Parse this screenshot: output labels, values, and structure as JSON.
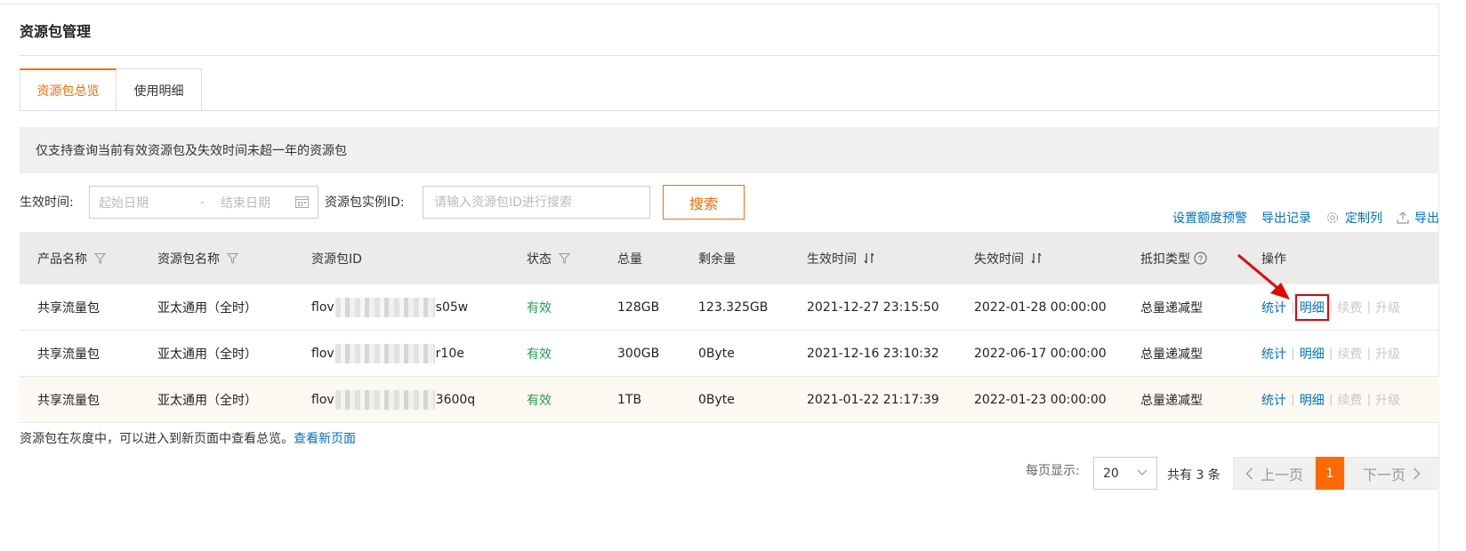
{
  "page": {
    "title": "资源包管理"
  },
  "tabs": [
    {
      "label": "资源包总览",
      "active": true
    },
    {
      "label": "使用明细",
      "active": false
    }
  ],
  "notice": "仅支持查询当前有效资源包及失效时间未超一年的资源包",
  "filters": {
    "time_label": "生效时间:",
    "start_placeholder": "起始日期",
    "range_sep": "-",
    "end_placeholder": "结束日期",
    "id_label": "资源包实例ID:",
    "id_placeholder": "请输入资源包ID进行搜索",
    "search_label": "搜索"
  },
  "toolbar": {
    "quota_alert": "设置额度预警",
    "export_records": "导出记录",
    "custom_columns": "定制列",
    "export": "导出"
  },
  "columns": {
    "product": "产品名称",
    "package_name": "资源包名称",
    "package_id": "资源包ID",
    "status": "状态",
    "total": "总量",
    "remaining": "剩余量",
    "effective_time": "生效时间",
    "expire_time": "失效时间",
    "deduct_type": "抵扣类型",
    "actions": "操作"
  },
  "rows": [
    {
      "product": "共享流量包",
      "package_name": "亚太通用（全时）",
      "id_prefix": "flov",
      "id_suffix": "s05w",
      "status": "有效",
      "total": "128GB",
      "remaining": "123.325GB",
      "effective_time": "2021-12-27 23:15:50",
      "expire_time": "2022-01-28 00:00:00",
      "deduct_type": "总量递减型"
    },
    {
      "product": "共享流量包",
      "package_name": "亚太通用（全时）",
      "id_prefix": "flov",
      "id_suffix": "r10e",
      "status": "有效",
      "total": "300GB",
      "remaining": "0Byte",
      "effective_time": "2021-12-16 23:10:32",
      "expire_time": "2022-06-17 00:00:00",
      "deduct_type": "总量递减型"
    },
    {
      "product": "共享流量包",
      "package_name": "亚太通用（全时）",
      "id_prefix": "flov",
      "id_suffix": "3600q",
      "status": "有效",
      "total": "1TB",
      "remaining": "0Byte",
      "effective_time": "2021-01-22 21:17:39",
      "expire_time": "2022-01-23 00:00:00",
      "deduct_type": "总量递减型"
    }
  ],
  "row_actions": {
    "stats": "统计",
    "detail": "明细",
    "renew": "续费",
    "upgrade": "升级"
  },
  "footnote": {
    "text": "资源包在灰度中，可以进入到新页面中查看总览。",
    "link": "查看新页面"
  },
  "pagination": {
    "per_page_label": "每页显示:",
    "per_page_value": "20",
    "total_text": "共有 3 条",
    "prev": "上一页",
    "current_page": "1",
    "next": "下一页"
  },
  "colors": {
    "accent": "#ff6a00",
    "link": "#0070cc",
    "status_ok": "#1ea346",
    "annotation": "#e60000"
  }
}
